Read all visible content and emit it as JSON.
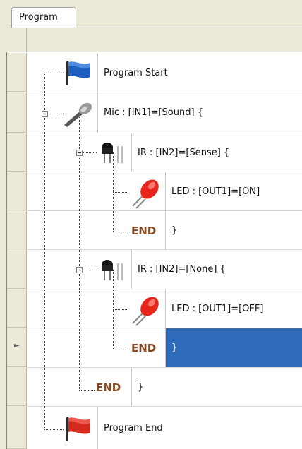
{
  "tab": {
    "label": "Program"
  },
  "rows": [
    {
      "text": "Program Start",
      "icon": "flag-blue-icon"
    },
    {
      "text": "Mic : [IN1]=[Sound] {",
      "icon": "microphone-icon"
    },
    {
      "text": "IR : [IN2]=[Sense] {",
      "icon": "ir-sensor-icon"
    },
    {
      "text": "LED : [OUT1]=[ON]",
      "icon": "led-red-icon"
    },
    {
      "text": "}",
      "keyword": "END"
    },
    {
      "text": "IR : [IN2]=[None] {",
      "icon": "ir-sensor-icon"
    },
    {
      "text": "LED : [OUT1]=[OFF]",
      "icon": "led-red-icon"
    },
    {
      "text": "}",
      "keyword": "END",
      "selected": true
    },
    {
      "text": "}",
      "keyword": "END"
    },
    {
      "text": "Program End",
      "icon": "flag-red-icon"
    }
  ],
  "colors": {
    "selection": "#2f6bbb",
    "end_keyword": "#8a4b24",
    "flag_blue": "#1f5fbf",
    "flag_red": "#d42a1e"
  }
}
